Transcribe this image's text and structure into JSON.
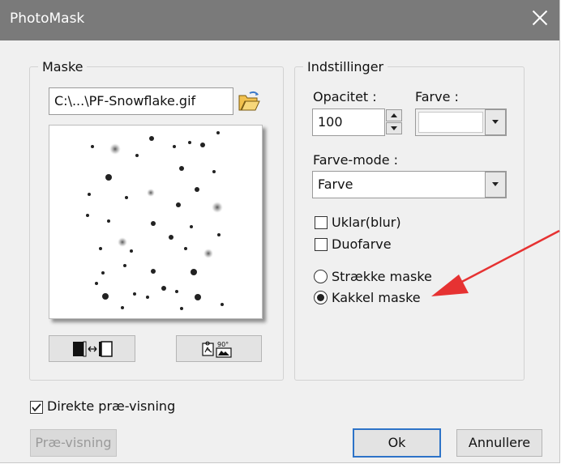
{
  "window": {
    "title": "PhotoMask"
  },
  "maske": {
    "legend": "Maske",
    "file_value": "C:\\...\\PF-Snowflake.gif",
    "preview_dots": [
      [
        141,
        183,
        7,
        1
      ],
      [
        186,
        170,
        3,
        0
      ],
      [
        214,
        180,
        2,
        0
      ],
      [
        233,
        175,
        2,
        0
      ],
      [
        249,
        178,
        3,
        0
      ],
      [
        113,
        180,
        2,
        0
      ],
      [
        268,
        163,
        2,
        0
      ],
      [
        168,
        191,
        2,
        0
      ],
      [
        133,
        218,
        4,
        0
      ],
      [
        223,
        207,
        3,
        0
      ],
      [
        263,
        211,
        2,
        0
      ],
      [
        185,
        237,
        5,
        1
      ],
      [
        109,
        239,
        2,
        0
      ],
      [
        155,
        243,
        2,
        0
      ],
      [
        219,
        252,
        3,
        0
      ],
      [
        267,
        255,
        7,
        1
      ],
      [
        242,
        233,
        3,
        0
      ],
      [
        133,
        272,
        2,
        0
      ],
      [
        188,
        275,
        3,
        0
      ],
      [
        235,
        279,
        2,
        0
      ],
      [
        269,
        289,
        2,
        0
      ],
      [
        107,
        265,
        2,
        0
      ],
      [
        150,
        298,
        6,
        1
      ],
      [
        210,
        292,
        3,
        0
      ],
      [
        123,
        306,
        2,
        0
      ],
      [
        256,
        312,
        6,
        1
      ],
      [
        161,
        309,
        2,
        0
      ],
      [
        228,
        306,
        2,
        0
      ],
      [
        126,
        336,
        2,
        0
      ],
      [
        188,
        334,
        3,
        0
      ],
      [
        238,
        335,
        4,
        0
      ],
      [
        153,
        327,
        2,
        0
      ],
      [
        129,
        365,
        4,
        0
      ],
      [
        165,
        362,
        2,
        0
      ],
      [
        217,
        359,
        2,
        0
      ],
      [
        243,
        366,
        4,
        0
      ],
      [
        201,
        355,
        3,
        0
      ],
      [
        273,
        375,
        2,
        0
      ],
      [
        150,
        379,
        2,
        0
      ],
      [
        223,
        380,
        2,
        0
      ],
      [
        118,
        349,
        2,
        0
      ],
      [
        181,
        366,
        2,
        0
      ]
    ]
  },
  "indstillinger": {
    "legend": "Indstillinger",
    "opacitet_label": "Opacitet :",
    "opacitet_value": "100",
    "farve_label": "Farve :",
    "farve_mode_label": "Farve-mode :",
    "farve_mode_value": "Farve",
    "uklar_label": "Uklar(blur)",
    "duofarve_label": "Duofarve",
    "straekke_label": "Strække maske",
    "kakkel_label": "Kakkel maske"
  },
  "options": {
    "direkte_label": "Direkte præ-visning"
  },
  "buttons": {
    "preview_label": "Præ-visning",
    "ok_label": "Ok",
    "cancel_label": "Annullere"
  },
  "colors": {
    "arrow": "#e63232",
    "ok_border": "#2d73c8",
    "titlebar": "#7a7a7a"
  }
}
